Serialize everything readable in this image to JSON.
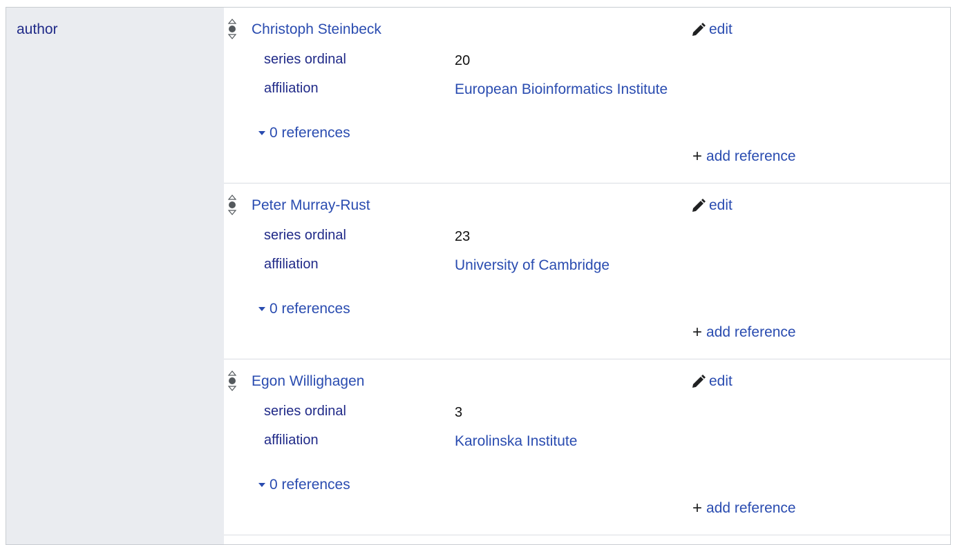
{
  "property": {
    "label": "author"
  },
  "statements": [
    {
      "value": "Christoph Steinbeck",
      "edit_label": "edit",
      "qualifiers": [
        {
          "property": "series ordinal",
          "value": "20"
        },
        {
          "property": "affiliation",
          "value": "European Bioinformatics Institute"
        }
      ],
      "references_label": "0 references",
      "add_reference_label": "add reference"
    },
    {
      "value": "Peter Murray-Rust",
      "edit_label": "edit",
      "qualifiers": [
        {
          "property": "series ordinal",
          "value": "23"
        },
        {
          "property": "affiliation",
          "value": "University of Cambridge"
        }
      ],
      "references_label": "0 references",
      "add_reference_label": "add reference"
    },
    {
      "value": "Egon Willighagen",
      "edit_label": "edit",
      "qualifiers": [
        {
          "property": "series ordinal",
          "value": "3"
        },
        {
          "property": "affiliation",
          "value": "Karolinska Institute"
        }
      ],
      "references_label": "0 references",
      "add_reference_label": "add reference"
    }
  ],
  "icons": {
    "rank": "rank-normal-icon",
    "edit": "pencil-icon",
    "toggle": "caret-down-icon",
    "add": "plus-icon"
  },
  "colors": {
    "link": "#2a4cb0",
    "property": "#202a88",
    "sidebar_bg": "#eaecf0",
    "border": "#c8ccd1"
  }
}
